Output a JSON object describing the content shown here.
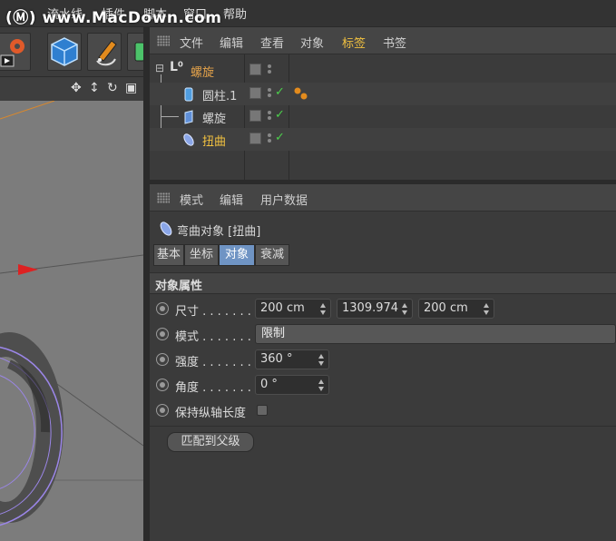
{
  "watermark": "(Ⓜ) www.MacDown.com",
  "menubar": {
    "items": [
      "流水线",
      "插件",
      "脚本",
      "窗口",
      "帮助"
    ]
  },
  "object_manager": {
    "menu": [
      "文件",
      "编辑",
      "查看",
      "对象",
      "标签",
      "书签"
    ],
    "active_menu": "标签",
    "tree": [
      {
        "name": "螺旋",
        "color": "#e2a14a",
        "level": 0
      },
      {
        "name": "圆柱.1",
        "color": "#d4d4d4",
        "level": 1
      },
      {
        "name": "螺旋",
        "color": "#d4d4d4",
        "level": 1
      },
      {
        "name": "扭曲",
        "color": "#f0c040",
        "level": 1
      }
    ],
    "check_glyph": "✓"
  },
  "attribute_manager": {
    "menu": [
      "模式",
      "编辑",
      "用户数据"
    ],
    "title": "弯曲对象 [扭曲]",
    "tabs": [
      "基本",
      "坐标",
      "对象",
      "衰减"
    ],
    "active_tab": "对象",
    "section": "对象属性",
    "props": {
      "size_label": "尺寸 . . . . . . .",
      "size_x": "200 cm",
      "size_y": "1309.974",
      "size_z": "200 cm",
      "mode_label": "模式 . . . . . . .",
      "mode_value": "限制",
      "strength_label": "强度 . . . . . . .",
      "strength_value": "360 °",
      "angle_label": "角度 . . . . . . .",
      "angle_value": "0 °",
      "keep_length_label": "保持纵轴长度"
    },
    "fit_button": "匹配到父级"
  },
  "colors": {
    "accent_tab": "#6f94c4",
    "active_menu": "#f0c040",
    "check": "#4ccf4c",
    "helix_stroke": "#9b86e8"
  }
}
